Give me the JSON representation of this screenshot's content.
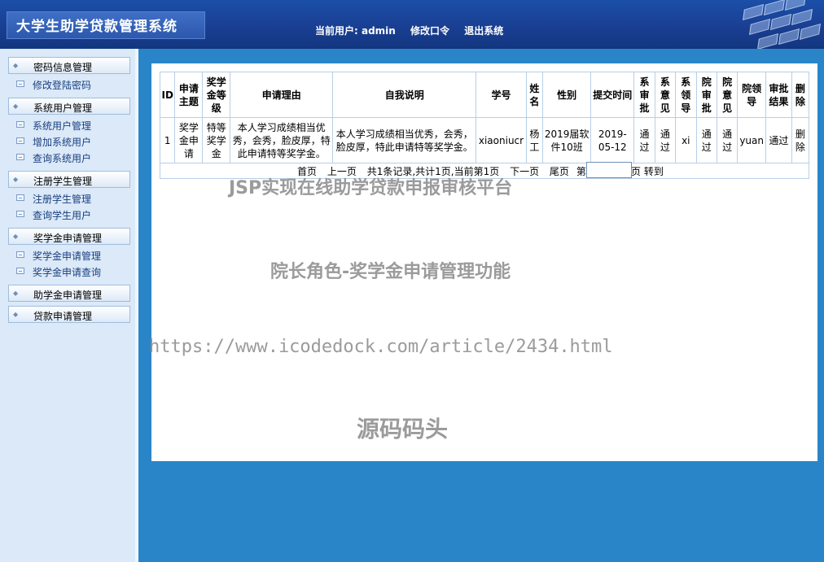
{
  "header": {
    "title": "大学生助学贷款管理系统",
    "current_user_label": "当前用户: admin",
    "change_password": "修改口令",
    "logout": "退出系统"
  },
  "sidebar": {
    "groups": [
      {
        "label": "密码信息管理",
        "items": [
          "修改登陆密码"
        ]
      },
      {
        "label": "系统用户管理",
        "items": [
          "系统用户管理",
          "增加系统用户",
          "查询系统用户"
        ]
      },
      {
        "label": "注册学生管理",
        "items": [
          "注册学生管理",
          "查询学生用户"
        ]
      },
      {
        "label": "奖学金申请管理",
        "items": [
          "奖学金申请管理",
          "奖学金申请查询"
        ]
      },
      {
        "label": "助学金申请管理",
        "items": []
      },
      {
        "label": "贷款申请管理",
        "items": []
      }
    ]
  },
  "table": {
    "headers": [
      "ID",
      "申请主题",
      "奖学金等级",
      "申请理由",
      "自我说明",
      "学号",
      "姓名",
      "性别",
      "提交时间",
      "系审批",
      "系意见",
      "系领导",
      "院审批",
      "院意见",
      "院领导",
      "审批结果",
      "删除"
    ],
    "rows": [
      [
        "1",
        "奖学金申请",
        "特等奖学金",
        "本人学习成绩相当优秀，会秀，脸皮厚，特此申请特等奖学金。",
        "本人学习成绩相当优秀，会秀，脸皮厚，特此申请特等奖学金。",
        "xiaoniucr",
        "杨工",
        "2019届软件10班",
        "2019-05-12",
        "通过",
        "通过",
        "xi",
        "通过",
        "通过",
        "yuan",
        "通过",
        "删除"
      ]
    ]
  },
  "pager": {
    "first": "首页",
    "prev": "上一页",
    "summary": "共1条记录,共计1页,当前第1页",
    "next": "下一页",
    "last": "尾页",
    "page_prefix": "第",
    "page_suffix": "页 转到",
    "page_value": ""
  },
  "watermarks": {
    "line1": "JSP实现在线助学贷款申报审核平台",
    "line2": "院长角色-奖学金申请管理功能",
    "line3": "https://www.icodedock.com/article/2434.html",
    "line4": "源码码头"
  }
}
